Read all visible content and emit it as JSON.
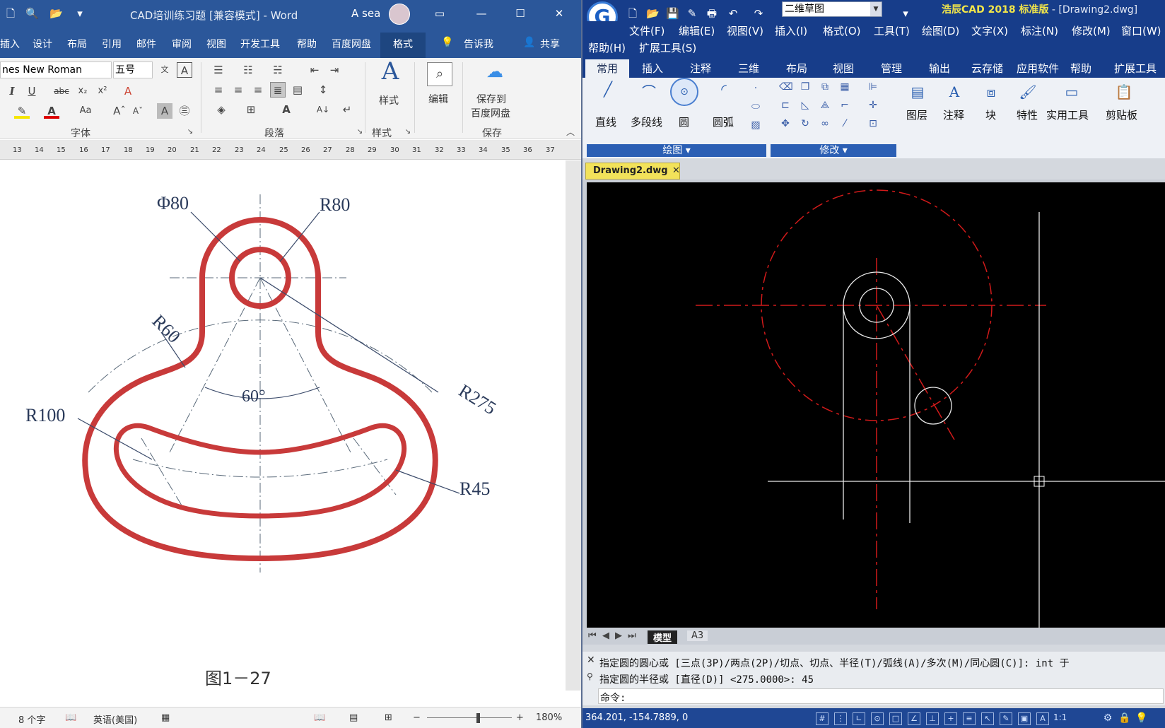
{
  "word": {
    "title": "CAD培训练习题 [兼容模式]  -  Word",
    "user": "A sea",
    "tabs": [
      "插入",
      "设计",
      "布局",
      "引用",
      "邮件",
      "审阅",
      "视图",
      "开发工具",
      "帮助",
      "百度网盘",
      "格式",
      "告诉我",
      "共享"
    ],
    "font_name": "nes New Roman",
    "font_size": "五号",
    "groups": {
      "font": "字体",
      "paragraph": "段落",
      "style": "样式",
      "save": "保存"
    },
    "buttons": {
      "style": "样式",
      "edit": "编辑",
      "save_to_1": "保存到",
      "save_to_2": "百度网盘"
    },
    "ruler": [
      "13",
      "14",
      "15",
      "16",
      "17",
      "18",
      "19",
      "20",
      "21",
      "22",
      "23",
      "24",
      "25",
      "26",
      "27",
      "28",
      "29",
      "30",
      "31",
      "32",
      "33",
      "34",
      "35",
      "36",
      "37"
    ],
    "drawing": {
      "dim_phi80": "Φ80",
      "dim_r80": "R80",
      "dim_r60": "R60",
      "dim_angle": "60°",
      "dim_r275": "R275",
      "dim_r100": "R100",
      "dim_r45": "R45",
      "caption": "图1－27"
    },
    "status": {
      "words": "8 个字",
      "language": "英语(美国)",
      "zoom": "180%"
    }
  },
  "cad": {
    "workspace": "二维草图",
    "title_brand": "浩辰CAD 2018 标准版",
    "title_file": " - [Drawing2.dwg]",
    "menu_row1": [
      "文件(F)",
      "编辑(E)",
      "视图(V)",
      "插入(I)",
      "格式(O)",
      "工具(T)",
      "绘图(D)",
      "文字(X)",
      "标注(N)",
      "修改(M)",
      "窗口(W)"
    ],
    "menu_row2": [
      "帮助(H)",
      "扩展工具(S)"
    ],
    "ribbon_tabs": [
      "常用",
      "插入",
      "注释",
      "三维",
      "布局",
      "视图",
      "管理",
      "输出",
      "云存储",
      "应用软件",
      "帮助",
      "扩展工具"
    ],
    "draw_tools": [
      "直线",
      "多段线",
      "圆",
      "圆弧"
    ],
    "big_tools": [
      "图层",
      "注释",
      "块",
      "特性",
      "实用工具",
      "剪贴板"
    ],
    "panel_draw": "绘图 ▾",
    "panel_modify": "修改 ▾",
    "file_tab": "Drawing2.dwg",
    "model_tabs": [
      "模型",
      "A3"
    ],
    "command_lines": [
      "指定圆的圆心或 [三点(3P)/两点(2P)/切点、切点、半径(T)/弧线(A)/多次(M)/同心圆(C)]: int 于",
      "指定圆的半径或 [直径(D)] <275.0000>: 45",
      "命令:"
    ],
    "coords": "364.201, -154.7889, 0",
    "scale": "1:1"
  }
}
